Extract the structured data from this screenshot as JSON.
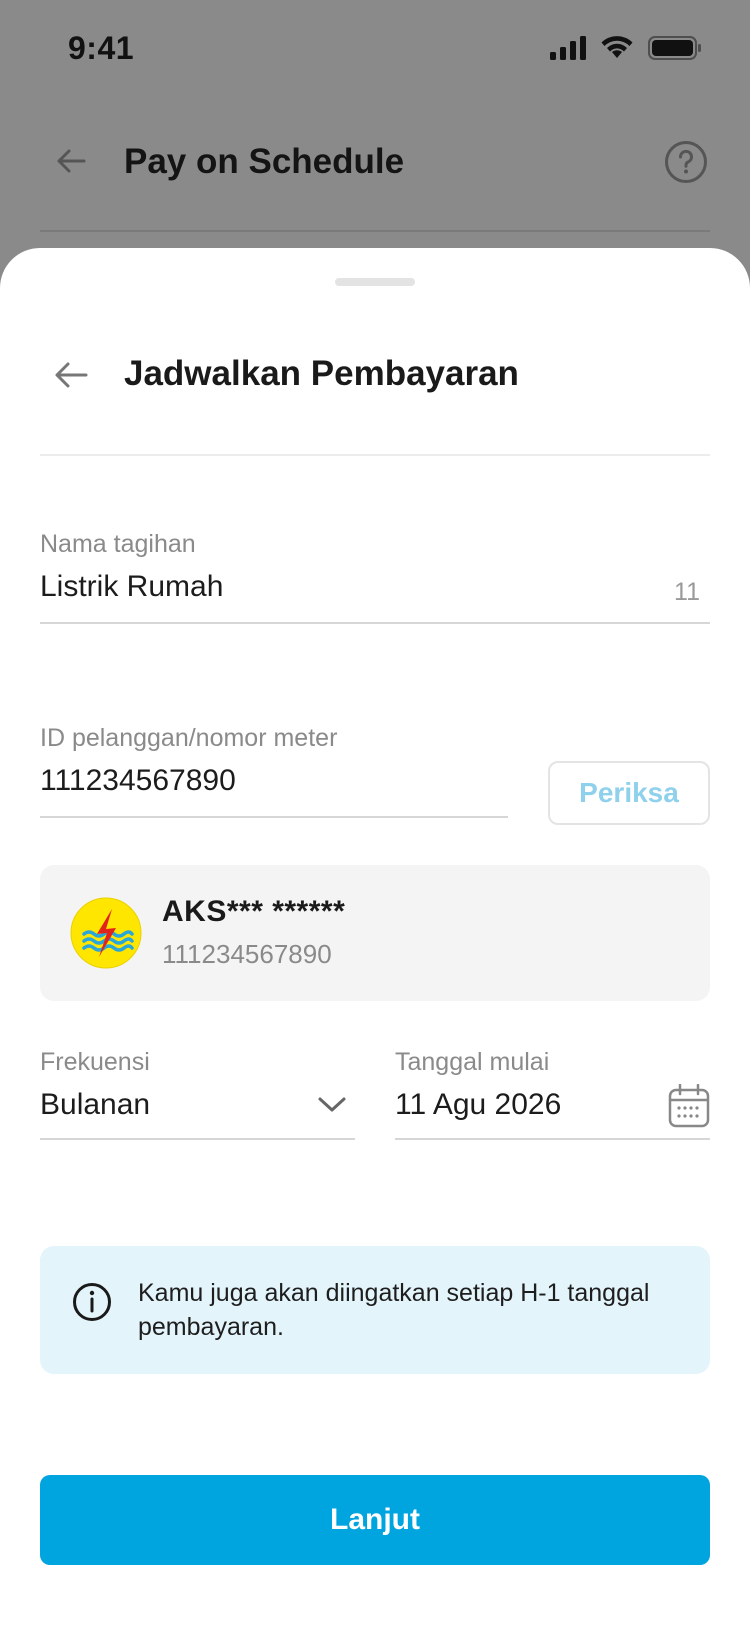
{
  "status_bar": {
    "time": "9:41"
  },
  "background_screen": {
    "title": "Pay on Schedule"
  },
  "sheet": {
    "title": "Jadwalkan Pembayaran",
    "bill_name": {
      "label": "Nama tagihan",
      "value": "Listrik Rumah",
      "char_count": "11"
    },
    "customer_id": {
      "label": "ID pelanggan/nomor meter",
      "value": "111234567890",
      "check_button": "Periksa"
    },
    "customer_card": {
      "name": "AKS*** ******",
      "id": "111234567890",
      "logo": "pln-logo-icon"
    },
    "frequency": {
      "label": "Frekuensi",
      "value": "Bulanan"
    },
    "start_date": {
      "label": "Tanggal mulai",
      "value": "11 Agu 2026"
    },
    "info": {
      "text": "Kamu juga akan diingatkan setiap H-1 tanggal pembayaran."
    },
    "continue_button": "Lanjut"
  },
  "colors": {
    "accent": "#00a5df",
    "check_button_text": "#8fd1ec",
    "info_bg": "#e3f4fb",
    "card_bg": "#f4f4f4",
    "overlay_bg": "#8a8a8a"
  }
}
